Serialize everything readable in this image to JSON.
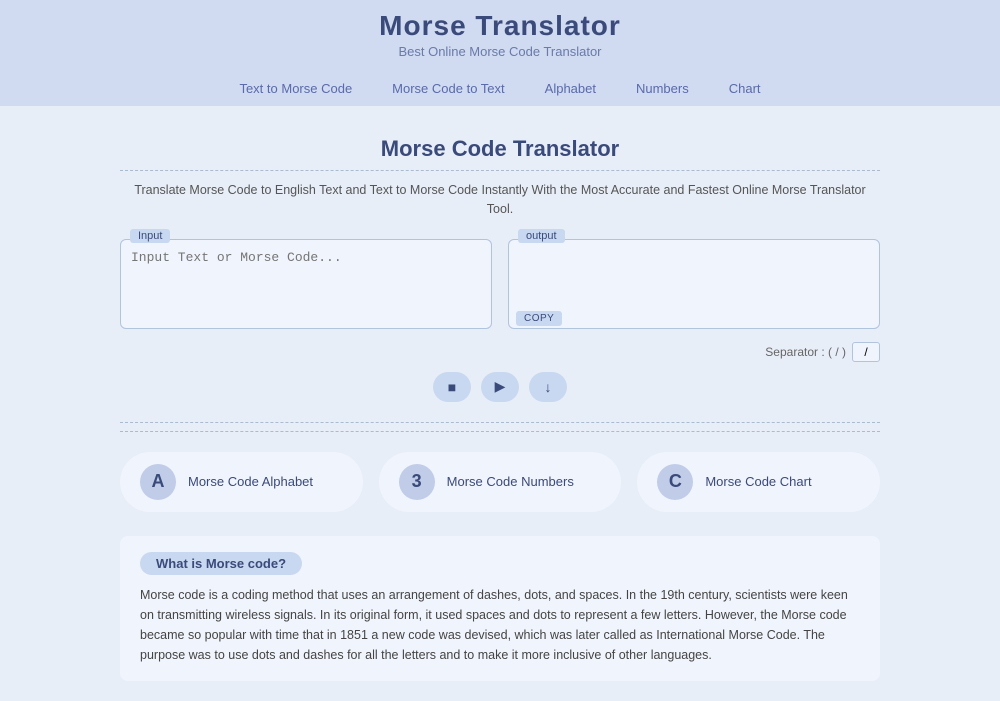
{
  "header": {
    "title": "Morse Translator",
    "subtitle": "Best Online Morse Code Translator"
  },
  "nav": {
    "items": [
      {
        "label": "Text to Morse Code",
        "id": "text-to-morse"
      },
      {
        "label": "Morse Code to Text",
        "id": "morse-to-text"
      },
      {
        "label": "Alphabet",
        "id": "alphabet"
      },
      {
        "label": "Numbers",
        "id": "numbers"
      },
      {
        "label": "Chart",
        "id": "chart"
      }
    ]
  },
  "main": {
    "section_title": "Morse Code Translator",
    "description": "Translate Morse Code to English Text and Text to Morse Code Instantly With the Most Accurate and Fastest Online Morse Translator Tool.",
    "input_label": "Input",
    "input_placeholder": "Input Text or Morse Code...",
    "output_label": "output",
    "copy_label": "COPY",
    "separator_label": "Separator : ( / )",
    "separator_value": "/",
    "buttons": {
      "stop": "■",
      "play": "▶",
      "download": "↓"
    }
  },
  "info_cards": [
    {
      "icon": "A",
      "label": "Morse Code Alphabet",
      "id": "alphabet-card"
    },
    {
      "icon": "3",
      "label": "Morse Code Numbers",
      "id": "numbers-card"
    },
    {
      "icon": "C",
      "label": "Morse Code Chart",
      "id": "chart-card"
    }
  ],
  "what_is": {
    "badge": "What is Morse code?",
    "text": "Morse code is a coding method that uses an arrangement of dashes, dots, and spaces. In the 19th century, scientists were keen on transmitting wireless signals. In its original form, it used spaces and dots to represent a few letters. However, the Morse code became so popular with time that in 1851 a new code was devised, which was later called as International Morse Code. The purpose was to use dots and dashes for all the letters and to make it more inclusive of other languages."
  }
}
